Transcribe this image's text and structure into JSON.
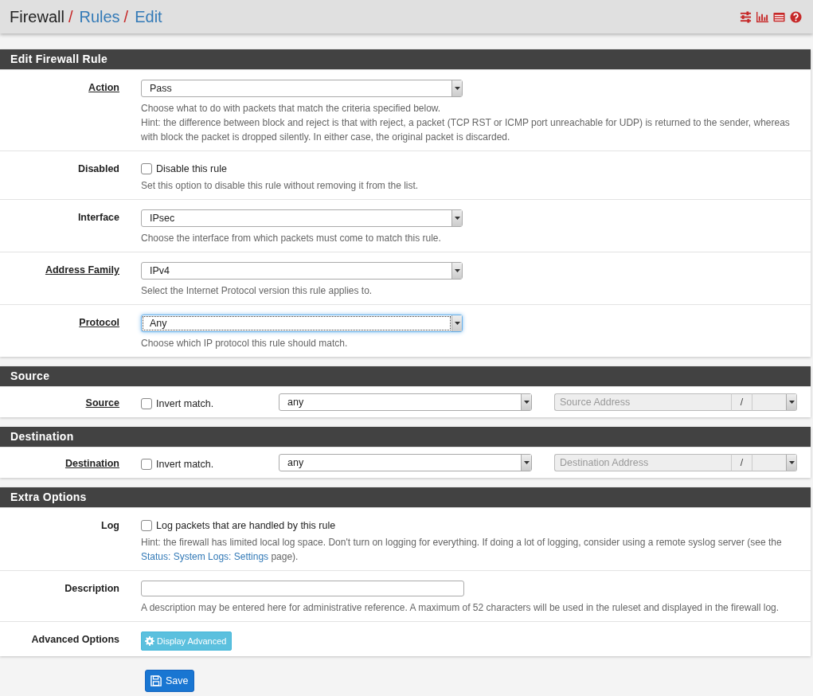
{
  "breadcrumb": [
    {
      "text": "Firewall",
      "link": false,
      "separator": "/"
    },
    {
      "text": "Rules",
      "link": true,
      "separator": "/"
    },
    {
      "text": "Edit",
      "link": true
    }
  ],
  "sections": [
    {
      "title": "Edit Firewall Rule",
      "rows": [
        {
          "kind": "select",
          "label": "Action",
          "linked": true,
          "value": "Pass",
          "focused": false,
          "help": [
            "Choose what to do with packets that match the criteria specified below.",
            "Hint: the difference between block and reject is that with reject, a packet (TCP RST or ICMP port unreachable for UDP) is returned to the sender, whereas with block the packet is dropped silently. In either case, the original packet is discarded."
          ]
        },
        {
          "kind": "checkbox",
          "label": "Disabled",
          "linked": false,
          "checked": false,
          "text": "Disable this rule",
          "help": [
            "Set this option to disable this rule without removing it from the list."
          ]
        },
        {
          "kind": "select",
          "label": "Interface",
          "linked": false,
          "value": "IPsec",
          "focused": false,
          "help": [
            "Choose the interface from which packets must come to match this rule."
          ]
        },
        {
          "kind": "select",
          "label": "Address Family",
          "linked": true,
          "value": "IPv4",
          "focused": false,
          "help": [
            "Select the Internet Protocol version this rule applies to."
          ]
        },
        {
          "kind": "select",
          "label": "Protocol",
          "linked": true,
          "value": "Any",
          "focused": true,
          "help": [
            "Choose which IP protocol this rule should match."
          ]
        }
      ]
    },
    {
      "title": "Source",
      "rows": [
        {
          "kind": "address",
          "label": "Source",
          "linked": true,
          "invert": {
            "label": "Invert match.",
            "checked": false
          },
          "type_value": "any",
          "address_placeholder": "Source Address",
          "slash": "/"
        }
      ]
    },
    {
      "title": "Destination",
      "rows": [
        {
          "kind": "address",
          "label": "Destination",
          "linked": true,
          "invert": {
            "label": "Invert match.",
            "checked": false
          },
          "type_value": "any",
          "address_placeholder": "Destination Address",
          "slash": "/"
        }
      ]
    },
    {
      "title": "Extra Options",
      "rows": [
        {
          "kind": "checkbox",
          "label": "Log",
          "linked": false,
          "checked": false,
          "text": "Log packets that are handled by this rule",
          "help": [
            {
              "before": "Hint: the firewall has limited local log space. Don't turn on logging for everything. If doing a lot of logging, consider using a remote syslog server (see the ",
              "link": "Status: System Logs: Settings",
              "after": " page)."
            }
          ]
        },
        {
          "kind": "text",
          "label": "Description",
          "linked": false,
          "help": [
            "A description may be entered here for administrative reference. A maximum of 52 characters will be used in the ruleset and displayed in the firewall log."
          ]
        },
        {
          "kind": "button",
          "label": "Advanced Options",
          "linked": false,
          "button": "Display Advanced"
        }
      ]
    }
  ],
  "save_button": {
    "label": "Save"
  }
}
